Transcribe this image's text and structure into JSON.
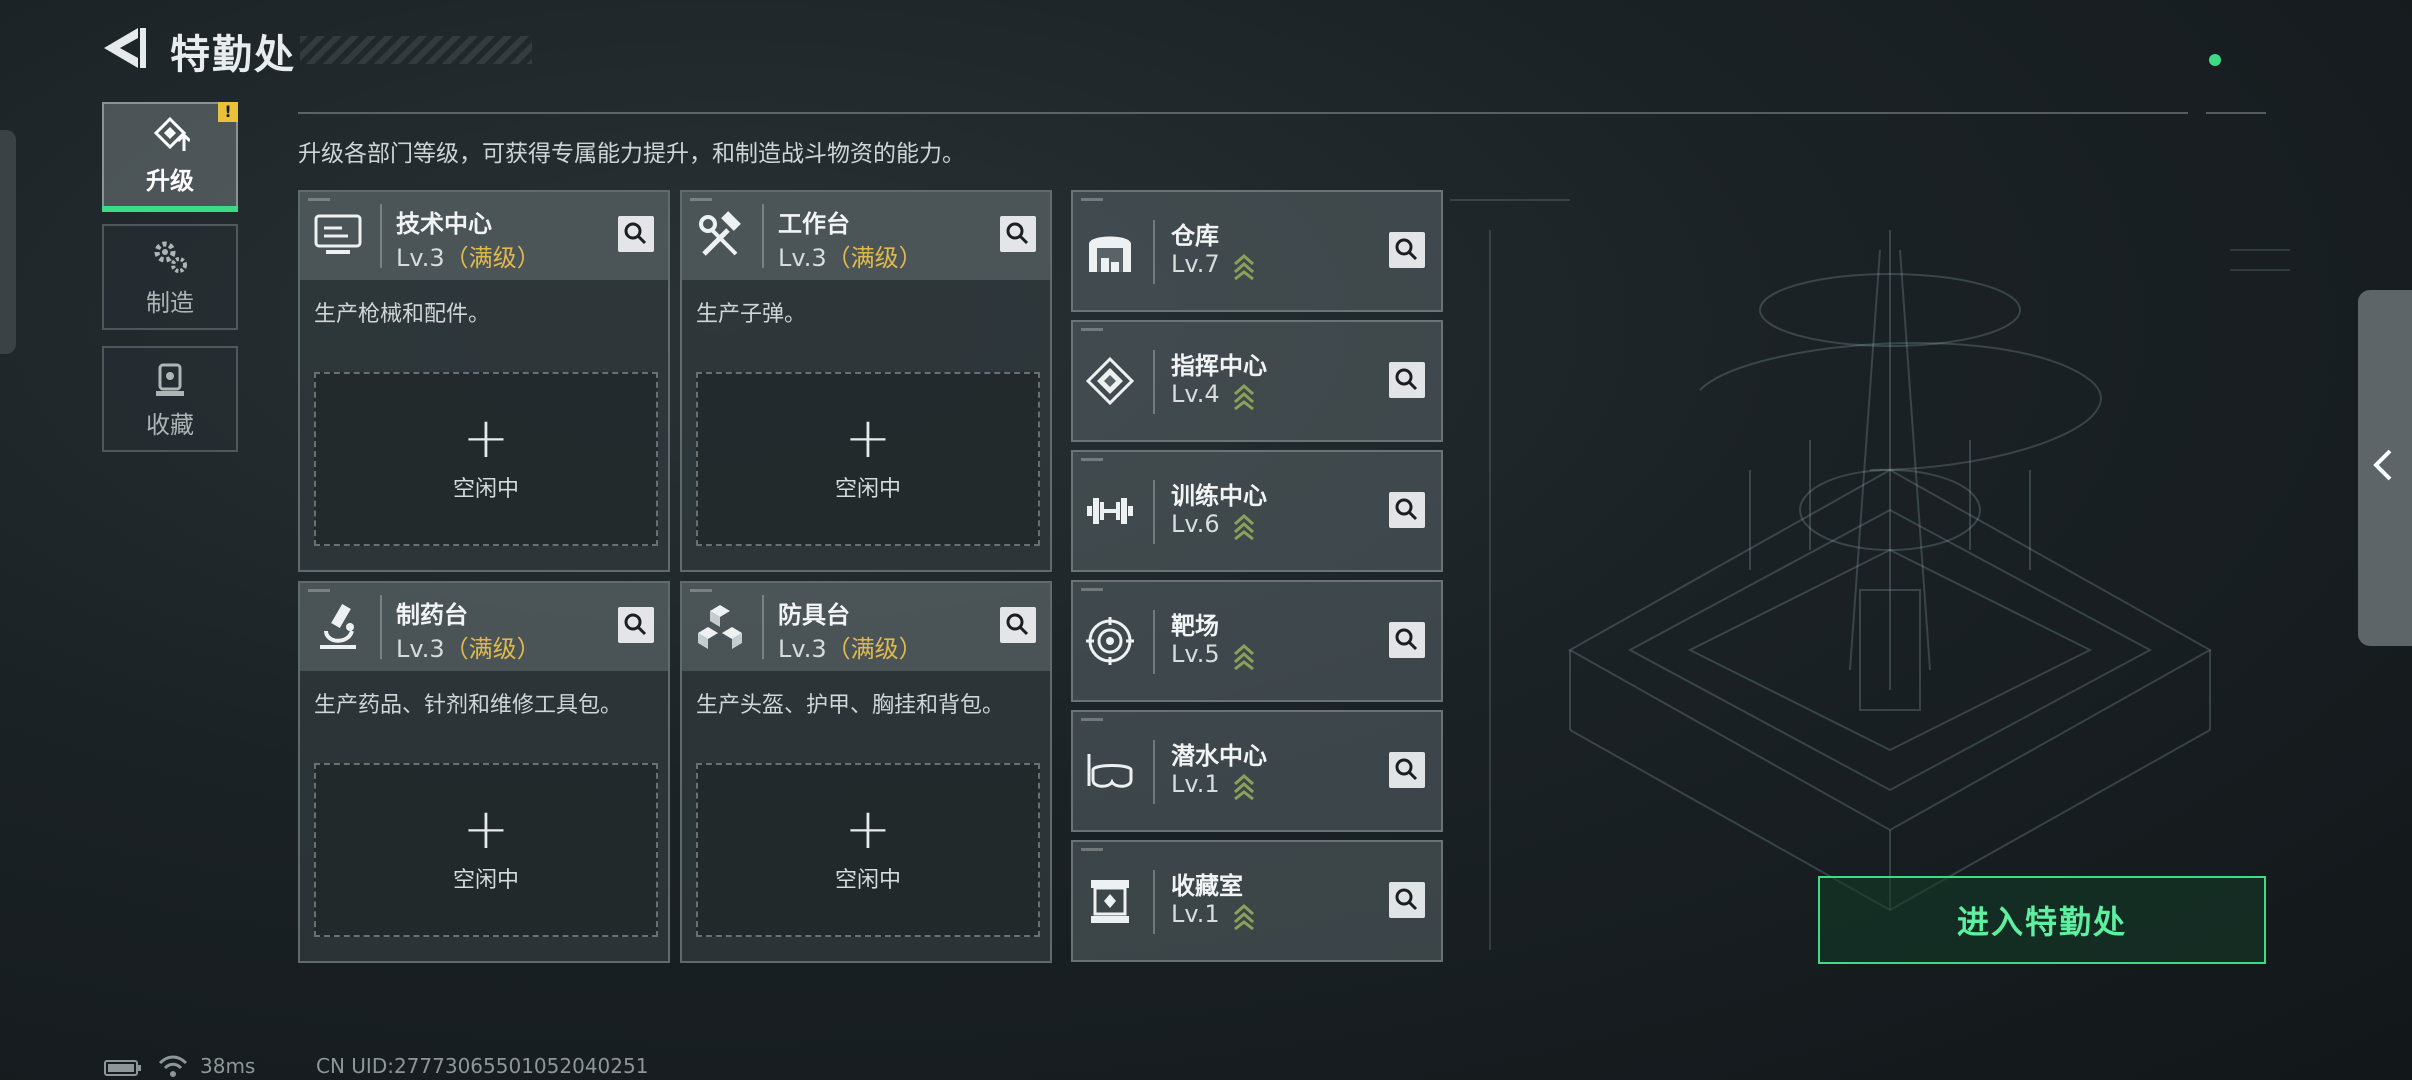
{
  "header": {
    "title": "特勤处"
  },
  "sidebar": {
    "items": [
      {
        "label": "升级",
        "active": true,
        "badge": "!"
      },
      {
        "label": "制造",
        "active": false
      },
      {
        "label": "收藏",
        "active": false
      }
    ]
  },
  "description": "升级各部门等级，可获得专属能力提升，和制造战斗物资的能力。",
  "workshops": [
    {
      "name": "技术中心",
      "level": "Lv.3",
      "max_tag": "（满级）",
      "desc": "生产枪械和配件。",
      "slot_plus": "+",
      "slot_status": "空闲中"
    },
    {
      "name": "工作台",
      "level": "Lv.3",
      "max_tag": "（满级）",
      "desc": "生产子弹。",
      "slot_plus": "+",
      "slot_status": "空闲中"
    },
    {
      "name": "制药台",
      "level": "Lv.3",
      "max_tag": "（满级）",
      "desc": "生产药品、针剂和维修工具包。",
      "slot_plus": "+",
      "slot_status": "空闲中"
    },
    {
      "name": "防具台",
      "level": "Lv.3",
      "max_tag": "（满级）",
      "desc": "生产头盔、护甲、胸挂和背包。",
      "slot_plus": "+",
      "slot_status": "空闲中"
    }
  ],
  "facilities": [
    {
      "name": "仓库",
      "level": "Lv.7"
    },
    {
      "name": "指挥中心",
      "level": "Lv.4"
    },
    {
      "name": "训练中心",
      "level": "Lv.6"
    },
    {
      "name": "靶场",
      "level": "Lv.5"
    },
    {
      "name": "潜水中心",
      "level": "Lv.1"
    },
    {
      "name": "收藏室",
      "level": "Lv.1"
    }
  ],
  "enter_button": "进入特勤处",
  "status": {
    "latency": "38ms",
    "uid": "CN UID:27773065501052040251"
  },
  "colors": {
    "accent": "#3ddc84",
    "max_level": "#e0b94d",
    "warning": "#e8c23a"
  }
}
